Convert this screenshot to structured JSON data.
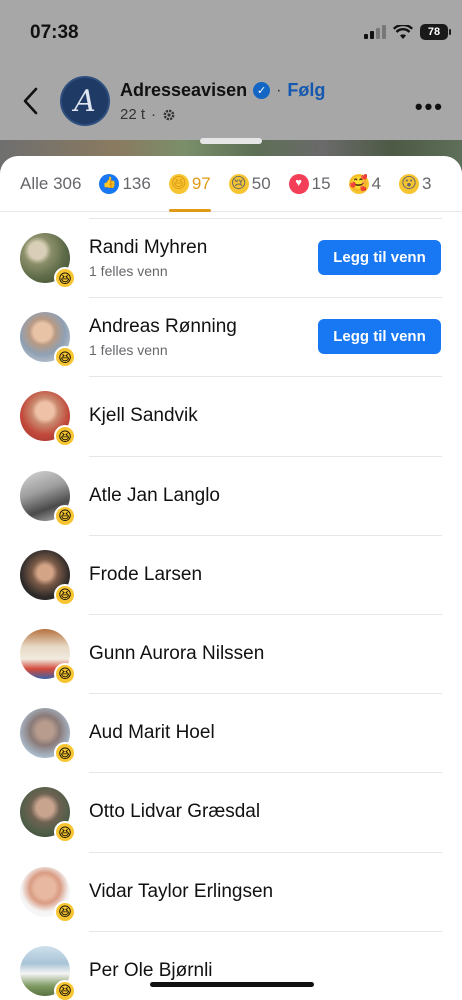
{
  "status": {
    "time": "07:38",
    "battery": "78"
  },
  "post": {
    "page_name": "Adresseavisen",
    "follow": "Følg",
    "age": "22 t",
    "avatar_letter": "A"
  },
  "tabs": [
    {
      "label": "Alle 306",
      "icon": ""
    },
    {
      "label": "136",
      "icon": "like-icon"
    },
    {
      "label": "97",
      "icon": "haha-icon",
      "active": true
    },
    {
      "label": "50",
      "icon": "sad-icon"
    },
    {
      "label": "15",
      "icon": "love-icon"
    },
    {
      "label": "4",
      "icon": "care-icon"
    },
    {
      "label": "3",
      "icon": "wow-icon"
    }
  ],
  "add_friend_label": "Legg til venn",
  "people": [
    {
      "name": "Randi Myhren",
      "mutual": "1 felles venn",
      "add": true
    },
    {
      "name": "Andreas Rønning",
      "mutual": "1 felles venn",
      "add": true
    },
    {
      "name": "Kjell Sandvik"
    },
    {
      "name": "Atle Jan Langlo"
    },
    {
      "name": "Frode Larsen"
    },
    {
      "name": "Gunn Aurora Nilssen"
    },
    {
      "name": "Aud Marit Hoel"
    },
    {
      "name": "Otto Lidvar Græsdal"
    },
    {
      "name": "Vidar Taylor Erlingsen"
    },
    {
      "name": "Per Ole Bjørnli"
    }
  ],
  "colors": {
    "accent": "#1877f2",
    "active_tab": "#e09a16"
  }
}
